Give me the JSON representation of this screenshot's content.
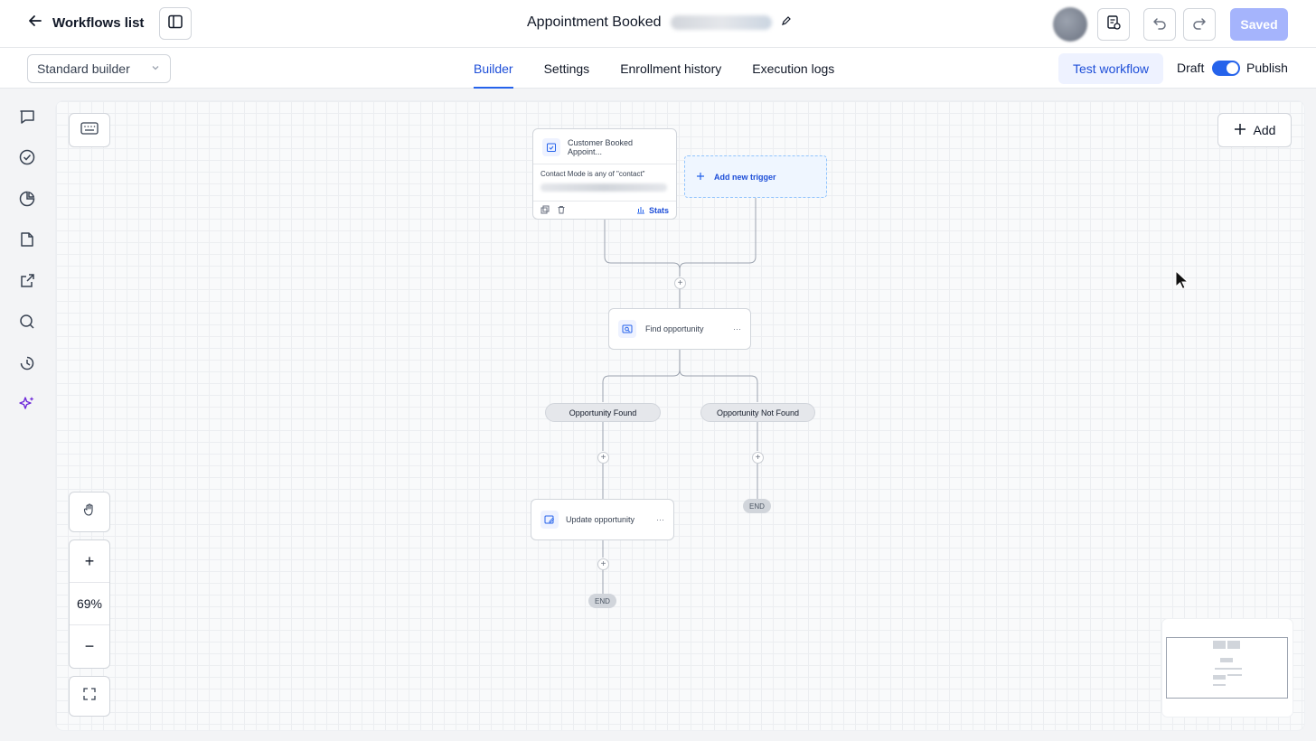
{
  "header": {
    "back_label": "Workflows list",
    "title": "Appointment Booked",
    "saved_label": "Saved"
  },
  "subbar": {
    "builder_select": "Standard builder",
    "tabs": [
      {
        "label": "Builder",
        "active": true
      },
      {
        "label": "Settings",
        "active": false
      },
      {
        "label": "Enrollment history",
        "active": false
      },
      {
        "label": "Execution logs",
        "active": false
      }
    ],
    "test_label": "Test workflow",
    "draft_label": "Draft",
    "publish_label": "Publish",
    "published": true
  },
  "rail": {
    "icons": [
      "chat-icon",
      "check-circle-icon",
      "pie-chart-icon",
      "document-icon",
      "external-link-icon",
      "search-icon",
      "history-icon",
      "sparkle-icon"
    ]
  },
  "canvas": {
    "add_label": "Add",
    "zoom_level": "69%",
    "zoom_in": "+",
    "zoom_out": "−",
    "trigger": {
      "title": "Customer Booked Appoint...",
      "filter": "Contact Mode is any of \"contact\"",
      "stats_label": "Stats"
    },
    "add_trigger_label": "Add new trigger",
    "find_node": "Find opportunity",
    "branch_found": "Opportunity Found",
    "branch_not_found": "Opportunity Not Found",
    "update_node": "Update opportunity",
    "end_label": "END",
    "more_label": "···",
    "plus_label": "+"
  },
  "colors": {
    "accent": "#2563eb",
    "saved_bg": "#a5b4fc"
  }
}
